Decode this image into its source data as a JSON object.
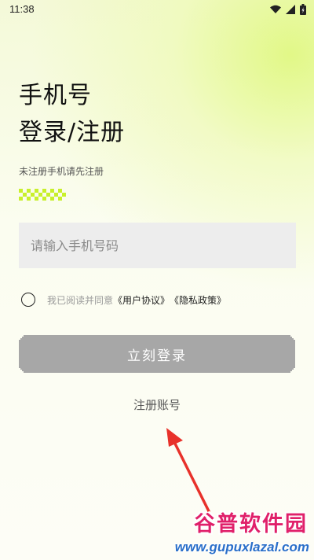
{
  "status_bar": {
    "time": "11:38",
    "icons": [
      "wifi-icon",
      "signal-icon",
      "battery-icon"
    ]
  },
  "login": {
    "title_line1": "手机号",
    "title_line2": "登录/注册",
    "hint": "未注册手机请先注册",
    "phone_placeholder": "请输入手机号码",
    "agree_prefix": "我已阅读并同意",
    "user_agreement": "《用户协议》",
    "privacy_policy": "《隐私政策》",
    "login_button": "立刻登录",
    "register_link": "注册账号"
  },
  "watermark": {
    "logo": "谷普软件园",
    "url": "www.gupuxlazal.com"
  },
  "colors": {
    "accent_green": "#c8f02a",
    "button_gray": "#a7a7a7",
    "input_bg": "#ededed",
    "arrow_red": "#e8312a",
    "watermark_pink": "#e0206a",
    "watermark_blue": "#2a6fc9"
  }
}
